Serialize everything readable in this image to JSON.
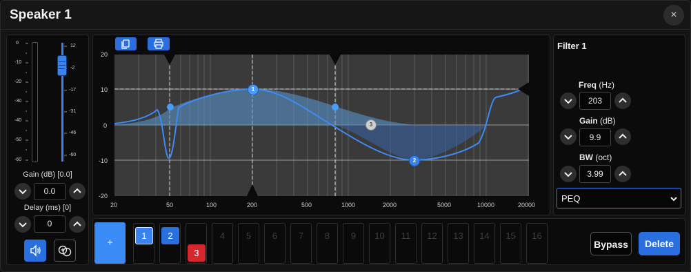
{
  "window": {
    "title": "Speaker 1",
    "close_glyph": "×"
  },
  "meter": {
    "left_ticks": [
      "0",
      "-10",
      "-20",
      "-30",
      "-40",
      "-50",
      "-60"
    ],
    "right_ticks": [
      "12",
      "-2",
      "-17",
      "-31",
      "-46",
      "-60"
    ],
    "slider_level_db": -2
  },
  "gain": {
    "label": "Gain (dB) [0.0]",
    "value": "0.0"
  },
  "delay": {
    "label": "Delay (ms) [0]",
    "value": "0"
  },
  "graph": {
    "y_ticks": [
      "20",
      "10",
      "0",
      "-10",
      "-20"
    ],
    "x_ticks": [
      "20",
      "50",
      "100",
      "200",
      "500",
      "1000",
      "2000",
      "5000",
      "10000",
      "20000"
    ],
    "toolbar": {
      "copy_icon": "copy-icon",
      "print_icon": "print-icon"
    },
    "filters": [
      {
        "label": "1",
        "freq_hz": 203,
        "gain_db": 9.9,
        "color": "#4a9cf5"
      },
      {
        "label": "2",
        "freq_hz": 3000,
        "gain_db": -10,
        "color": "#3a82ee"
      },
      {
        "label": "3",
        "freq_hz": 1400,
        "gain_db": 0,
        "color": "#cfcfcf"
      }
    ]
  },
  "filter_panel": {
    "title": "Filter 1",
    "freq": {
      "label_bold": "Freq",
      "label_unit": " (Hz)",
      "value": "203"
    },
    "gain": {
      "label_bold": "Gain",
      "label_unit": " (dB)",
      "value": "9.9"
    },
    "bw": {
      "label_bold": "BW",
      "label_unit": " (oct)",
      "value": "3.99"
    },
    "type_select": {
      "value": "PEQ"
    }
  },
  "bands": {
    "add_label": "+",
    "items": [
      "1",
      "2",
      "3",
      "4",
      "5",
      "6",
      "7",
      "8",
      "9",
      "10",
      "11",
      "12",
      "13",
      "14",
      "15",
      "16"
    ]
  },
  "actions": {
    "bypass": "Bypass",
    "delete": "Delete"
  },
  "colors": {
    "accent": "#2a6fe0",
    "danger": "#d6262e",
    "curve": "#4a8ff0"
  }
}
